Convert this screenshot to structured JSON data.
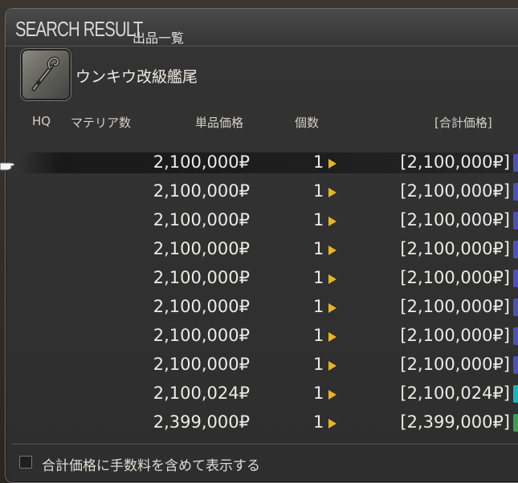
{
  "window": {
    "title_en": "SEARCH RESULT",
    "title_jp": "出品一覧"
  },
  "item": {
    "name": "ウンキウ改級艦尾",
    "icon": "wrench-hook-icon"
  },
  "columns": {
    "hq": "HQ",
    "materia": "マテリア数",
    "unit_price": "単品価格",
    "quantity": "個数",
    "total": "[合計価格]"
  },
  "listings": [
    {
      "price": "2,100,000₽",
      "qty": "1",
      "total": "[2,100,000₽]",
      "retainer_color": "#4a52b8"
    },
    {
      "price": "2,100,000₽",
      "qty": "1",
      "total": "[2,100,000₽]",
      "retainer_color": "#4a52b8"
    },
    {
      "price": "2,100,000₽",
      "qty": "1",
      "total": "[2,100,000₽]",
      "retainer_color": "#4a52b8"
    },
    {
      "price": "2,100,000₽",
      "qty": "1",
      "total": "[2,100,000₽]",
      "retainer_color": "#4a52b8"
    },
    {
      "price": "2,100,000₽",
      "qty": "1",
      "total": "[2,100,000₽]",
      "retainer_color": "#4a52b8"
    },
    {
      "price": "2,100,000₽",
      "qty": "1",
      "total": "[2,100,000₽]",
      "retainer_color": "#4a52b8"
    },
    {
      "price": "2,100,000₽",
      "qty": "1",
      "total": "[2,100,000₽]",
      "retainer_color": "#4a52b8"
    },
    {
      "price": "2,100,000₽",
      "qty": "1",
      "total": "[2,100,000₽]",
      "retainer_color": "#4a52b8"
    },
    {
      "price": "2,100,024₽",
      "qty": "1",
      "total": "[2,100,024₽]",
      "retainer_color": "#18b4c0"
    },
    {
      "price": "2,399,000₽",
      "qty": "1",
      "total": "[2,399,000₽]",
      "retainer_color": "#3aa050"
    }
  ],
  "footer": {
    "checkbox_label": "合計価格に手数料を含めて表示する",
    "checked": false
  }
}
